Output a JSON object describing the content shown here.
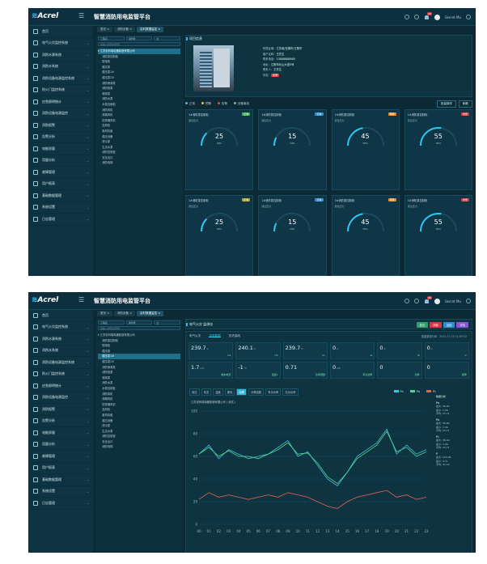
{
  "app": {
    "logo": "Acrel",
    "title": "智慧消防用电监管平台",
    "user": "Secret Mu",
    "badge": "99"
  },
  "sidebar": [
    {
      "label": "首页"
    },
    {
      "label": "电气火灾监控系统"
    },
    {
      "label": "消防水源系统"
    },
    {
      "label": "消防水系统"
    },
    {
      "label": "消防设备电源监控系统"
    },
    {
      "label": "防火门监控系统"
    },
    {
      "label": "应急照明统计"
    },
    {
      "label": "消防设备电源监控"
    },
    {
      "label": "消防报警"
    },
    {
      "label": "告警分析"
    },
    {
      "label": "电能质量"
    },
    {
      "label": "用量分析"
    },
    {
      "label": "故障管理"
    },
    {
      "label": "用户报表"
    },
    {
      "label": "基础数据管理"
    },
    {
      "label": "系统设置"
    },
    {
      "label": "日志管理"
    }
  ],
  "shot1": {
    "tabs": [
      "首页",
      "消防设备",
      "实时数据监控"
    ],
    "tree": {
      "filters": [
        "工程名",
        "消防泵",
        "全"
      ],
      "search": "请输入搜索关键字",
      "nodes": [
        "江苏安科瑞电器制造有限公司",
        "消防泵控制柜",
        "配电柜",
        "稳压泵",
        "稳压泵1#",
        "稳压泵2#",
        "消防喷淋泵",
        "消防栓泵",
        "喷淋泵",
        "消防水泵",
        "水泵控制柜",
        "消防风机",
        "排烟风机",
        "防排烟风机",
        "送风机",
        "新风机组",
        "稳压设备",
        "排污泵",
        "生活水泵",
        "消防控制室",
        "安全出口",
        "消防电梯"
      ]
    },
    "info": {
      "title": "项目信息",
      "rows": [
        [
          "所属区域",
          "江苏省/无锡市/江阴市"
        ],
        [
          "客户名称",
          "王先生"
        ],
        [
          "联系电话",
          "13888888888"
        ],
        [
          "地址",
          "江阴市长山大道5号"
        ],
        [
          "联系人",
          "王先生"
        ]
      ],
      "tag": "告警"
    },
    "legend": {
      "items": [
        "正常",
        "预警",
        "告警",
        "设备离线"
      ],
      "colors": [
        "#2fc6ef",
        "#f3c02b",
        "#ef4545",
        "#8aa2ad"
      ],
      "btns": [
        "批量操作",
        "刷新"
      ]
    },
    "cards": [
      {
        "title": "1#消防泵控制柜",
        "tag": "正常",
        "tagColor": "#39b54a",
        "label": "液位压力",
        "value": 25,
        "unit": "MPa"
      },
      {
        "title": "1#消防泵控制柜",
        "tag": "正常",
        "tagColor": "#2d8fd6",
        "label": "液位压力",
        "value": 15,
        "unit": "MPa"
      },
      {
        "title": "1#消防泵控制柜",
        "tag": "预警",
        "tagColor": "#e78a28",
        "label": "液位压力",
        "value": 45,
        "unit": "MPa"
      },
      {
        "title": "1#消防泵控制柜",
        "tag": "告警",
        "tagColor": "#d8383a",
        "label": "液位压力",
        "value": 55,
        "unit": "MPa"
      },
      {
        "title": "1#消防泵控制柜",
        "tag": "正常",
        "tagColor": "#b5a21c",
        "label": "液位压力",
        "value": 25,
        "unit": "MPa"
      },
      {
        "title": "1#消防泵控制柜",
        "tag": "正常",
        "tagColor": "#2d8fd6",
        "label": "液位压力",
        "value": 15,
        "unit": "MPa"
      },
      {
        "title": "1#消防泵控制柜",
        "tag": "预警",
        "tagColor": "#e78a28",
        "label": "液位压力",
        "value": 45,
        "unit": "MPa"
      },
      {
        "title": "1#消防泵控制柜",
        "tag": "告警",
        "tagColor": "#d8383a",
        "label": "液位压力",
        "value": 55,
        "unit": "MPa"
      }
    ]
  },
  "shot2": {
    "tabs": [
      "首页",
      "消防设备",
      "实时数据监控"
    ],
    "title": "电气火灾 监测仪",
    "buttons": [
      {
        "label": "复位",
        "color": "#2aa36b"
      },
      {
        "label": "消音",
        "color": "#d43c3c"
      },
      {
        "label": "自检",
        "color": "#2d8fd6"
      },
      {
        "label": "详情",
        "color": "#8a55d6"
      }
    ],
    "subtabs": [
      "电气火灾",
      "实时数据",
      "历史曲线"
    ],
    "subtabs_right": "数据更新时间：2022-11-14 11:05:32",
    "metrics": [
      {
        "v": "239.7",
        "u": "V",
        "l": "Ua"
      },
      {
        "v": "240.1",
        "u": "V",
        "l": "Ub"
      },
      {
        "v": "239.7",
        "u": "V",
        "l": "Uc"
      },
      {
        "v": "0",
        "u": "A",
        "l": "Ia"
      },
      {
        "v": "0",
        "u": "A",
        "l": "Ib"
      },
      {
        "v": "0",
        "u": "A",
        "l": "Ic"
      },
      {
        "v": "1.7",
        "u": "mA",
        "l": "剩余电流"
      },
      {
        "v": "-1",
        "u": "℃",
        "l": "温度1"
      },
      {
        "v": "0.71",
        "u": "",
        "l": "功率因数"
      },
      {
        "v": "0",
        "u": "kW",
        "l": "有功功率"
      },
      {
        "v": "0",
        "u": "",
        "l": "功率"
      },
      {
        "v": "0",
        "u": "",
        "l": "频率"
      }
    ],
    "chart_tabs": [
      "电压",
      "电流",
      "温度",
      "漏电",
      "功率",
      "功率因数",
      "有功功率",
      "无功功率"
    ],
    "chart_title": "江苏安科瑞电器制造有限公司 ( 测试 )",
    "side_title": "数据分析",
    "side": [
      {
        "name": "Pa",
        "rows": [
          "最大: 36.63",
          "最小: 1.30",
          "平均: 15.71"
        ]
      },
      {
        "name": "Pb",
        "rows": [
          "最大: 36.63",
          "最小: 1.30",
          "平均: 15.71"
        ]
      },
      {
        "name": "Pc",
        "rows": [
          "最大: 36.40",
          "最小: 1.20",
          "平均: 15.71"
        ]
      },
      {
        "name": "P",
        "rows": [
          "最大: 110.96",
          "最小: 3.71",
          "平均: 47.12"
        ]
      }
    ]
  },
  "chart_data": {
    "type": "line",
    "title": "",
    "xlabel": "",
    "ylabel": "",
    "ylim": [
      0,
      100
    ],
    "yticks": [
      0,
      20,
      40,
      60,
      80,
      100
    ],
    "x": [
      "00",
      "01",
      "02",
      "03",
      "04",
      "05",
      "06",
      "07",
      "08",
      "09",
      "10",
      "11",
      "12",
      "13",
      "14",
      "15",
      "16",
      "17",
      "18",
      "19",
      "20",
      "21",
      "22",
      "23"
    ],
    "series": [
      {
        "name": "Pa",
        "color": "#3fc3e2",
        "values": [
          62,
          70,
          58,
          66,
          62,
          58,
          60,
          62,
          68,
          74,
          60,
          64,
          52,
          40,
          34,
          46,
          60,
          66,
          72,
          84,
          62,
          70,
          62,
          66
        ]
      },
      {
        "name": "Pb",
        "color": "#53d68a",
        "values": [
          62,
          68,
          60,
          65,
          60,
          60,
          58,
          62,
          66,
          72,
          62,
          63,
          54,
          42,
          36,
          46,
          58,
          64,
          70,
          82,
          64,
          68,
          60,
          64
        ]
      },
      {
        "name": "Pc",
        "color": "#e4664a",
        "values": [
          22,
          28,
          24,
          26,
          24,
          22,
          24,
          26,
          24,
          28,
          26,
          24,
          20,
          16,
          14,
          20,
          24,
          26,
          28,
          30,
          24,
          26,
          22,
          24
        ]
      }
    ],
    "legend": [
      "Pa",
      "Pb",
      "Pc"
    ]
  }
}
